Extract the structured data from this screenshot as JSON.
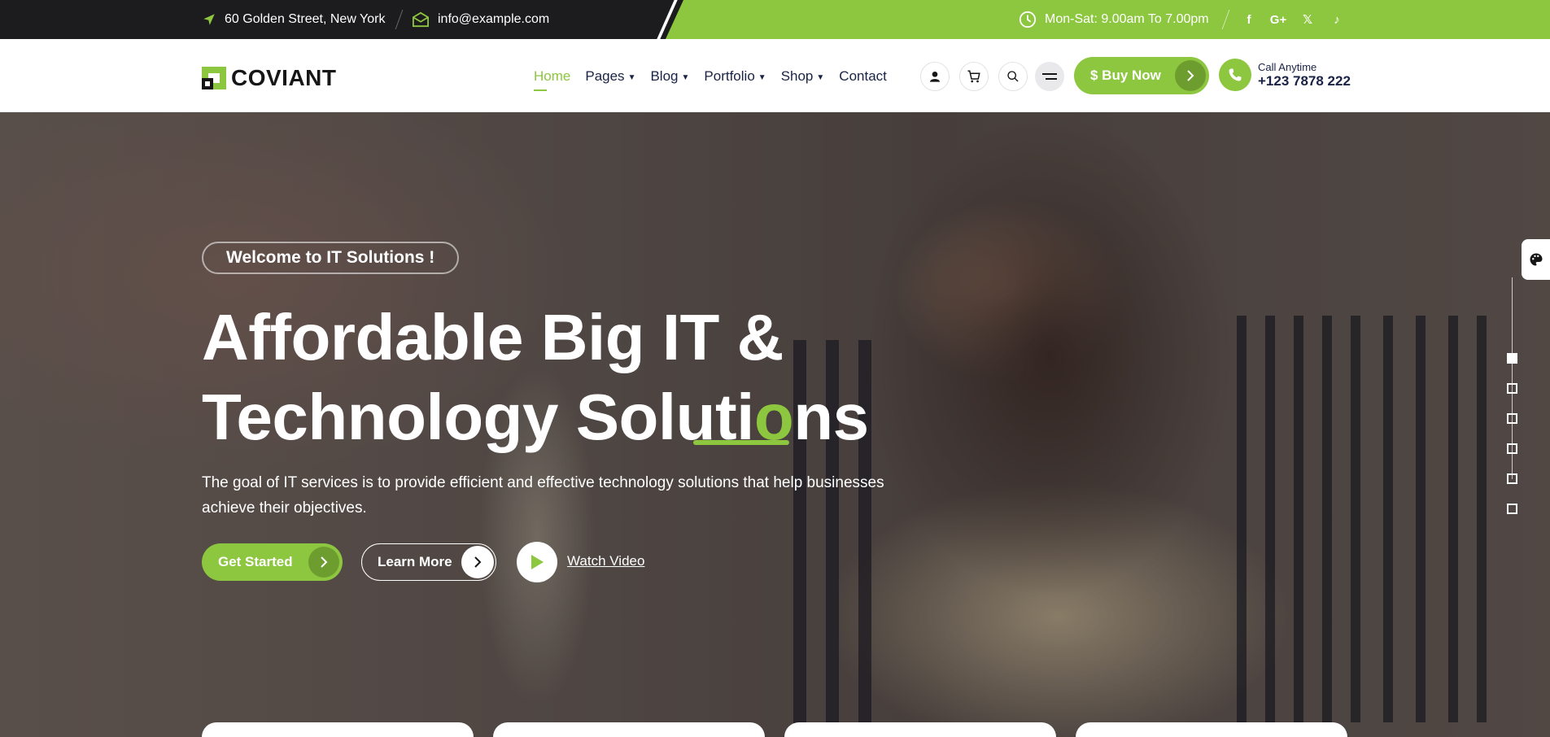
{
  "topbar": {
    "address": "60 Golden Street, New York",
    "email": "info@example.com",
    "hours": "Mon-Sat: 9.00am To 7.00pm",
    "social": [
      "f",
      "G+",
      "𝕏",
      "♪"
    ]
  },
  "header": {
    "logo": "COVIANT",
    "nav": [
      {
        "label": "Home",
        "dropdown": false,
        "active": true
      },
      {
        "label": "Pages",
        "dropdown": true
      },
      {
        "label": "Blog",
        "dropdown": true
      },
      {
        "label": "Portfolio",
        "dropdown": true
      },
      {
        "label": "Shop",
        "dropdown": true
      },
      {
        "label": "Contact",
        "dropdown": false
      }
    ],
    "buy_label": "$ Buy Now",
    "call_caption": "Call Anytime",
    "call_number": "+123 7878 222"
  },
  "hero": {
    "badge": "Welcome to IT Solutions !",
    "headline_line1": "Affordable Big IT &",
    "headline_line2_a": "Technology Soluti",
    "headline_line2_o": "o",
    "headline_line2_b": "ns",
    "subtext": "The goal of IT services is to provide efficient and effective technology solutions that help businesses achieve their objectives.",
    "get_started": "Get Started",
    "learn_more": "Learn More",
    "watch_video": "Watch Video",
    "slide_count": 6,
    "active_slide": 1
  },
  "colors": {
    "accent": "#8dc63f",
    "dark": "#1c1b1d",
    "navy": "#1a2346"
  }
}
